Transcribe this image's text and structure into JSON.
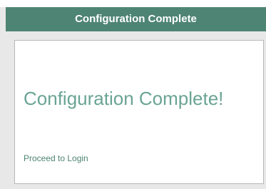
{
  "window": {
    "title": "Configuration Complete"
  },
  "content": {
    "headline": "Configuration Complete!",
    "proceed_link": "Proceed to Login"
  },
  "colors": {
    "title_bar_bg": "#4e8474",
    "headline_text": "#6aa494",
    "link_text": "#4e8474"
  }
}
